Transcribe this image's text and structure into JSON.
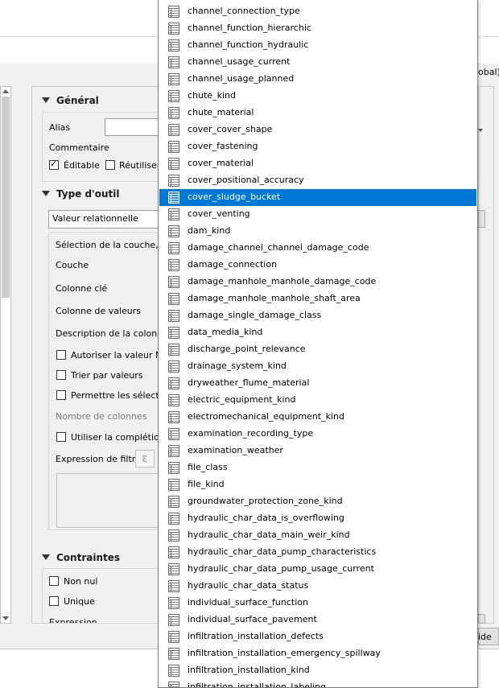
{
  "right_partial": {
    "combo_fragment": "obal)",
    "button_fragment": "ide"
  },
  "sections": {
    "general": {
      "title": "Général",
      "alias_label": "Alias",
      "comment_label": "Commentaire",
      "editable_label": "Éditable",
      "reuse_label": "Réutiliser"
    },
    "widget_type": {
      "title": "Type d'outil",
      "type_value": "Valeur relationnelle",
      "layer_selection_label": "Sélection de la couche, de",
      "layer_label": "Couche",
      "key_column_label": "Colonne clé",
      "value_column_label": "Colonne de valeurs",
      "column_description_label": "Description de la colonne",
      "allow_null_label": "Autoriser la valeur NUL",
      "sort_by_value_label": "Trier par valeurs",
      "allow_multiple_label": "Permettre les sélection",
      "column_count_label": "Nombre de colonnes",
      "use_completer_label": "Utiliser la complétion",
      "filter_expression_label": "Expression de filtre",
      "epsilon_glyph": "ε"
    },
    "constraints": {
      "title": "Contraintes",
      "not_null_label": "Non nul",
      "unique_label": "Unique",
      "expression_label": "Expression"
    }
  },
  "dropdown": {
    "icon": "table-icon",
    "selected_index": 11,
    "items": [
      "channel_connection_type",
      "channel_function_hierarchic",
      "channel_function_hydraulic",
      "channel_usage_current",
      "channel_usage_planned",
      "chute_kind",
      "chute_material",
      "cover_cover_shape",
      "cover_fastening",
      "cover_material",
      "cover_positional_accuracy",
      "cover_sludge_bucket",
      "cover_venting",
      "dam_kind",
      "damage_channel_channel_damage_code",
      "damage_connection",
      "damage_manhole_manhole_damage_code",
      "damage_manhole_manhole_shaft_area",
      "damage_single_damage_class",
      "data_media_kind",
      "discharge_point_relevance",
      "drainage_system_kind",
      "dryweather_flume_material",
      "electric_equipment_kind",
      "electromechanical_equipment_kind",
      "examination_recording_type",
      "examination_weather",
      "file_class",
      "file_kind",
      "groundwater_protection_zone_kind",
      "hydraulic_char_data_is_overflowing",
      "hydraulic_char_data_main_weir_kind",
      "hydraulic_char_data_pump_characteristics",
      "hydraulic_char_data_pump_usage_current",
      "hydraulic_char_data_status",
      "individual_surface_function",
      "individual_surface_pavement",
      "infiltration_installation_defects",
      "infiltration_installation_emergency_spillway",
      "infiltration_installation_kind",
      "infiltration_installation_labeling"
    ]
  },
  "colors": {
    "selection": "#0078d7",
    "dialog_bg": "#f0f0f0"
  }
}
